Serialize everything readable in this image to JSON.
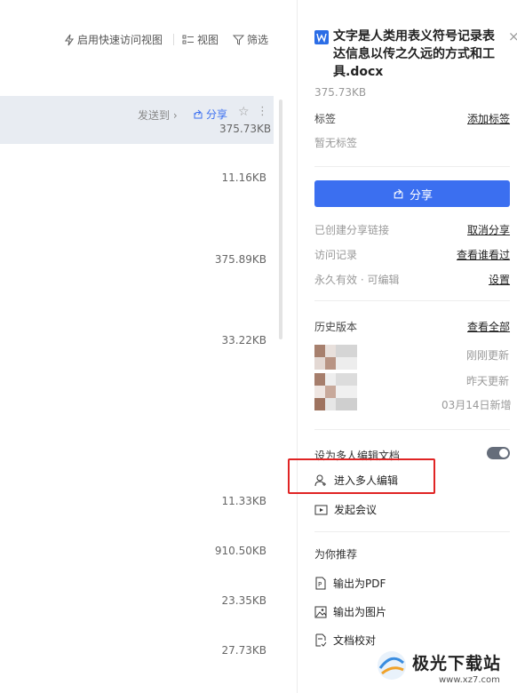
{
  "toolbar": {
    "quick_view": "启用快速访问视图",
    "view": "视图",
    "filter": "筛选"
  },
  "file_list": {
    "selected_row": {
      "send_to": "发送到",
      "share": "分享",
      "size": "375.73KB"
    },
    "sizes": [
      "11.16KB",
      "375.89KB",
      "33.22KB",
      "11.33KB",
      "910.50KB",
      "23.35KB",
      "27.73KB"
    ]
  },
  "panel": {
    "file_title": "文字是人类用表义符号记录表达信息以传之久远的方式和工具.docx",
    "file_size": "375.73KB",
    "tags_label": "标签",
    "add_tag": "添加标签",
    "no_tags": "暂无标签",
    "share_button": "分享",
    "share_link_created": "已创建分享链接",
    "cancel_share": "取消分享",
    "access_log": "访问记录",
    "view_who": "查看谁看过",
    "permission": "永久有效 · 可编辑",
    "settings": "设置",
    "history_label": "历史版本",
    "view_all": "查看全部",
    "history_items": [
      "刚刚更新",
      "昨天更新",
      "03月14日新增"
    ],
    "multi_edit_label": "设为多人编辑文档",
    "enter_multi_edit": "进入多人编辑",
    "start_meeting": "发起会议",
    "recommend_label": "为你推荐",
    "export_pdf": "输出为PDF",
    "export_image": "输出为图片",
    "proofread": "文档校对"
  },
  "watermark": {
    "brand": "极光下载站",
    "url": "www.xz7.com"
  },
  "colors": {
    "accent": "#3b6ff0",
    "highlight_box": "#e02424",
    "word_icon": "#2b6de6"
  }
}
